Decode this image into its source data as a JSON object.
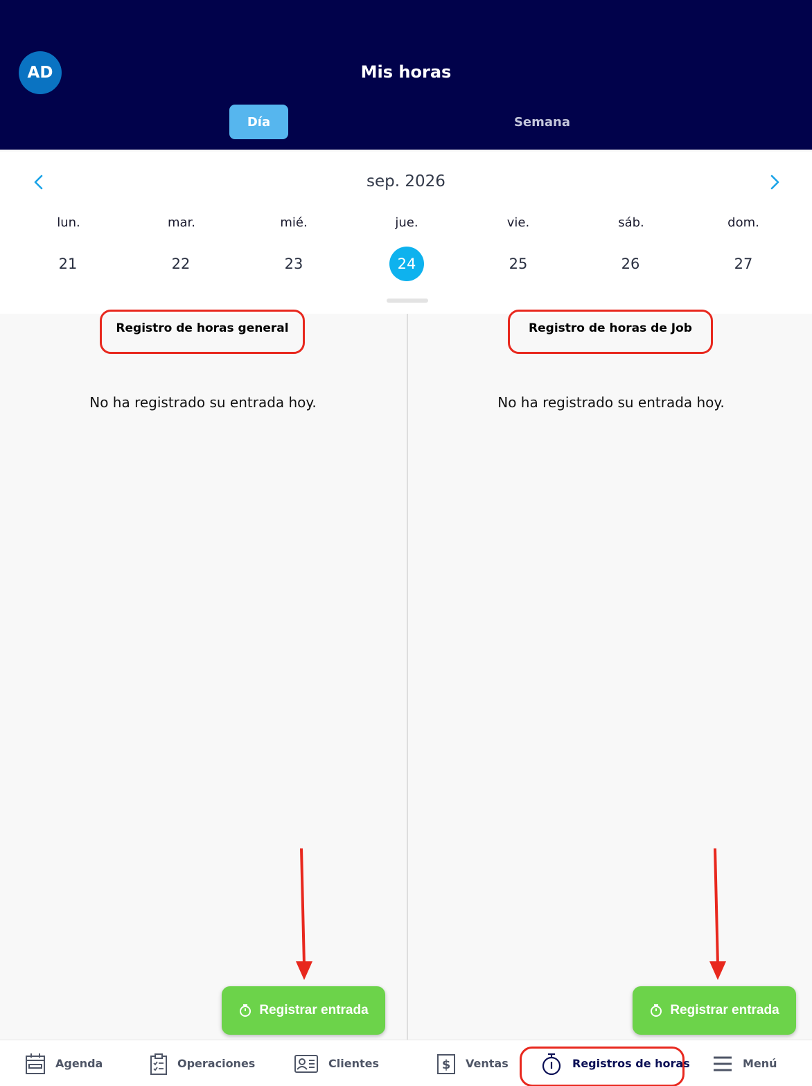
{
  "header": {
    "avatar_initials": "AD",
    "title": "Mis horas",
    "segments": [
      {
        "label": "Día",
        "active": true
      },
      {
        "label": "Semana",
        "active": false
      }
    ]
  },
  "calendar": {
    "month_label": "sep. 2026",
    "days": [
      {
        "weekday": "lun.",
        "day": "21"
      },
      {
        "weekday": "mar.",
        "day": "22"
      },
      {
        "weekday": "mié.",
        "day": "23"
      },
      {
        "weekday": "jue.",
        "day": "24",
        "selected": true
      },
      {
        "weekday": "vie.",
        "day": "25"
      },
      {
        "weekday": "sáb.",
        "day": "26"
      },
      {
        "weekday": "dom.",
        "day": "27"
      }
    ]
  },
  "panels": [
    {
      "title": "Registro de horas general",
      "message": "No ha registrado su entrada hoy.",
      "button_label": "Registrar entrada"
    },
    {
      "title": "Registro de horas de Job",
      "message": "No ha registrado su entrada hoy.",
      "button_label": "Registrar entrada"
    }
  ],
  "tabbar": {
    "items": [
      {
        "label": "Agenda",
        "icon": "calendar-icon"
      },
      {
        "label": "Operaciones",
        "icon": "clipboard-icon"
      },
      {
        "label": "Clientes",
        "icon": "contact-card-icon"
      },
      {
        "label": "Ventas",
        "icon": "dollar-icon"
      },
      {
        "label": "Registros de horas",
        "icon": "stopwatch-icon",
        "active": true
      },
      {
        "label": "Menú",
        "icon": "hamburger-icon"
      }
    ]
  },
  "colors": {
    "header_bg": "#01024b",
    "accent_blue": "#0eb2ee",
    "button_green": "#6cd34a",
    "annotation_red": "#e8281e"
  }
}
